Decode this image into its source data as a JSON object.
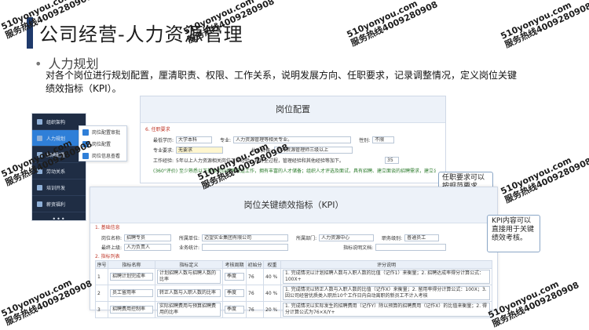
{
  "slide": {
    "title": "公司经营-人力资源管理",
    "bullet": "人力规划",
    "description": "对各个岗位进行规划配置，厘清职责、权限、工作关系，说明发展方向、任职要求，记录调整情况，定义岗位关键绩效指标（KPI）。"
  },
  "nav": {
    "items": [
      {
        "label": "组织架构"
      },
      {
        "label": "人力规划"
      },
      {
        "label": "招聘配置"
      },
      {
        "label": "劳动关系"
      },
      {
        "label": "培训开发"
      },
      {
        "label": "薪资福利"
      }
    ],
    "more": "•••",
    "subitems": [
      {
        "label": "岗位配置审批"
      },
      {
        "label": "岗位配置"
      },
      {
        "label": "岗位信息查看"
      }
    ]
  },
  "job_config": {
    "title": "岗位配置",
    "section": "6. 任职要求",
    "education_label": "最低学历:",
    "education_value": "大学本科",
    "major_label": "专业:",
    "major_value": "人力资源管理等相关专业。",
    "gender_label": "性别:",
    "gender_value": "不限",
    "major_req_label": "专业要求:",
    "major_req_value": "无要求",
    "cert_label": "执业资格:",
    "cert_value": "人力资源管理师三级以上",
    "exp_label": "工作经验:",
    "exp_value": "5年以上人力资源相关岗位工作经验，具有全过程，管理经验和其他经验等加下。",
    "age_value": "35",
    "green_text": "(360°评价) 至少熟悉以下基本岗位招聘渠道工作，拥有丰富的人才储备；组织人才评选及面试，具有招聘、建立面谈的招聘需求，建立公司的人才储备和培养制度，具备健全个人才能，部分关键岗位人才储备。"
  },
  "callouts": {
    "c1": "任职要求可以按规范要求",
    "c2": "KPI内容可以直接用于关键绩效考核。"
  },
  "kpi": {
    "title": "岗位关键绩效指标（KPI）",
    "section1": "1. 基础信息",
    "post_label": "岗位名称:",
    "post_value": "招聘专员",
    "unit_label": "所属单位:",
    "unit_value": "迈望实业集团有限公司",
    "dept_label": "所属部门:",
    "dept_value": "人力资源中心",
    "rank_label": "职务级别:",
    "rank_value": "普通员工",
    "owner_label": "最终上级:",
    "owner_value": "人力负责人",
    "method_label": "业务统计:",
    "source_label": "指标说明文档:",
    "section2": "2. 指标列表",
    "headers": [
      "序号",
      "指标名称",
      "指标定义",
      "考核周期",
      "初始分",
      "权重",
      "评分说明"
    ],
    "rows": [
      {
        "no": "1",
        "name": "招聘计划完成率",
        "def": "计划招聘人数与招聘人数的比率",
        "period": "季度",
        "score": "76",
        "weight": "40 %",
        "desc": "1. 完成情况以计划招聘人数与入职人数的比值（记作1）来衡量；2. 招聘达成率得分计算公式：100X+"
      },
      {
        "no": "2",
        "name": "员工留用率",
        "def": "转正人数与入职人数的比率",
        "period": "季度",
        "score": "76",
        "weight": "40 %",
        "desc": "1. 完成情况以转正人数与入职人数的比值（记作X）来衡量；2. 留用率得分计算公式：100X；3. 因公司经营优质类入职后10个工作日内自动离职的新员工不计入考核"
      },
      {
        "no": "3",
        "name": "招聘费用控制率",
        "def": "实际招聘费用与预算招聘费用的比率",
        "period": "季度",
        "score": "76",
        "weight": "20 %",
        "desc": "1. 完成情况以实际发生的招聘费用（记作Y）除以预算的招聘费用（记作X）的比值来衡量；2. 得分计算公式为76×X/Y+"
      }
    ]
  },
  "watermarks": {
    "w1": "510yonyou.com\n服务热线4009280908",
    "w2": "510yonyou.com\n服务热线4009280908",
    "w3": "510yonyou.com\n服务热线4009280908",
    "w4": "510yonyou.com\n服务热线4009280908",
    "w5": "510yonyou.com\n服务热线4009280908",
    "w6": "510yonyou.com\n服务热线4009280908",
    "w7": "510yonyou.com\n服务热线4009280908",
    "w8": "510yonyou.com\n服务热线4009280908",
    "w9": "510yonyou.com\n服务热线4009280908"
  }
}
